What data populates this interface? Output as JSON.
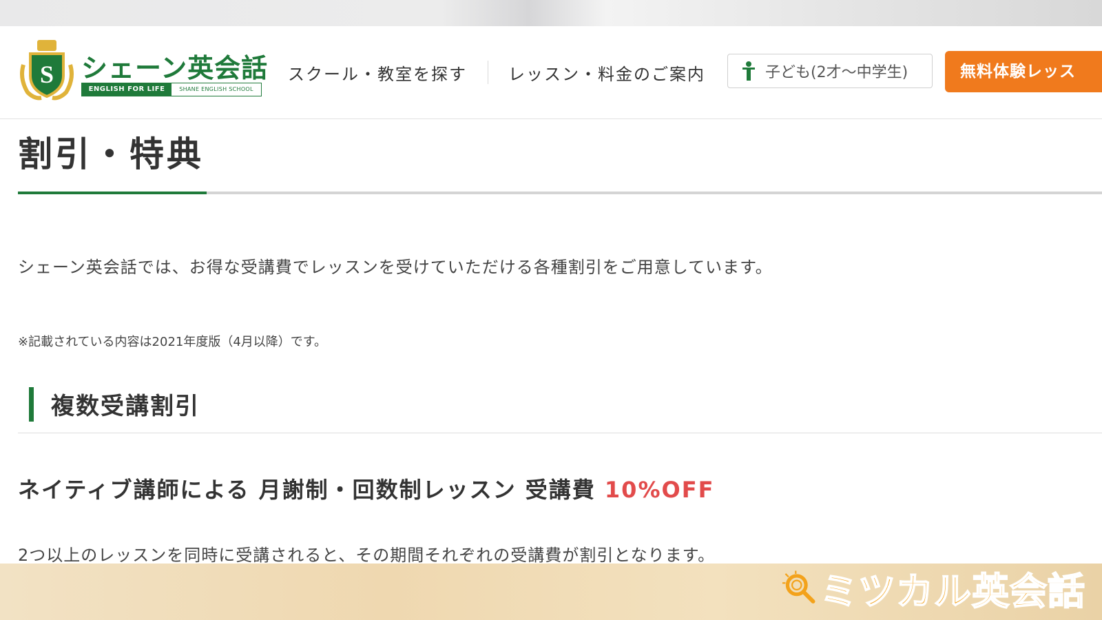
{
  "header": {
    "logo_text": "シェーン英会話",
    "logo_tagline_left": "ENGLISH FOR LIFE",
    "logo_tagline_right": "SHANE ENGLISH SCHOOL",
    "nav": [
      {
        "label": "スクール・教室を探す"
      },
      {
        "label": "レッスン・料金のご案内"
      }
    ],
    "kids_button_label": "子ども(2才〜中学生)",
    "trial_button_label": "無料体験レッス"
  },
  "main": {
    "page_title": "割引・特典",
    "intro": "シェーン英会話では、お得な受講費でレッスンを受けていただける各種割引をご用意しています。",
    "note": "※記載されている内容は2021年度版（4月以降）です。",
    "section_title": "複数受講割引",
    "sub_heading_prefix": "ネイティブ講師による 月謝制・回数制レッスン 受講費 ",
    "sub_heading_accent": "10%OFF",
    "body_text": "2つ以上のレッスンを同時に受講されると、その期間それぞれの受講費が割引となります。"
  },
  "watermark": {
    "text": "ミツカル英会話"
  },
  "colors": {
    "brand_green": "#1f7a3a",
    "cta_orange": "#f07a1d",
    "accent_red": "#e24b4b",
    "watermark_orange": "#f3a21b"
  },
  "icons": {
    "logo_emblem": "shield-crest-icon",
    "kids": "child-figure-icon",
    "watermark": "magnifier-icon"
  }
}
